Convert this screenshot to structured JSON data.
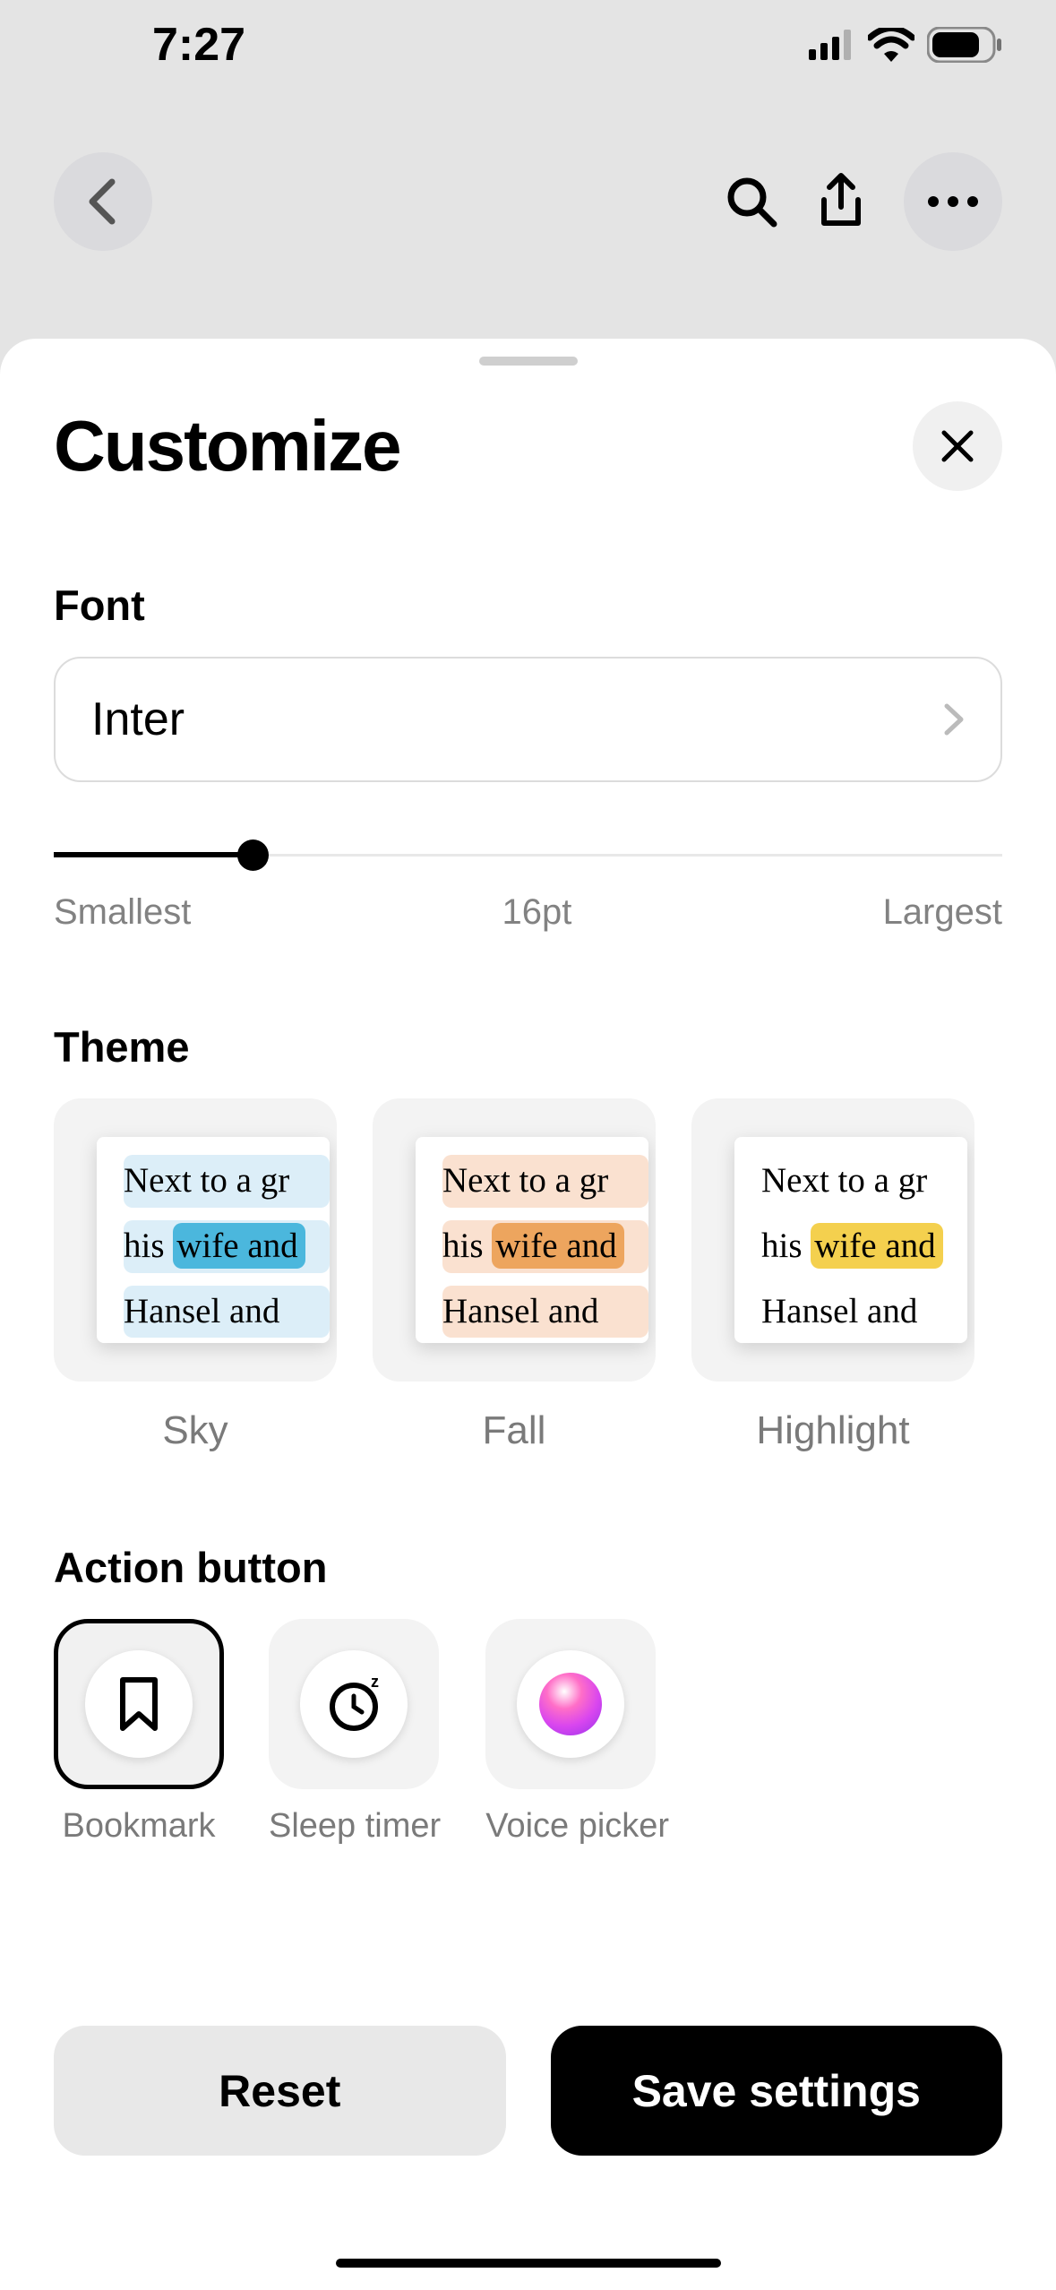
{
  "status": {
    "time": "7:27"
  },
  "sheet": {
    "title": "Customize",
    "font": {
      "label": "Font",
      "value": "Inter"
    },
    "slider": {
      "min_label": "Smallest",
      "mid_label": "16pt",
      "max_label": "Largest"
    },
    "theme": {
      "label": "Theme",
      "preview_lines": {
        "l1": "Next to a gr",
        "l2a": "his ",
        "l2b": "wife and",
        "l3": "Hansel and"
      },
      "items": [
        {
          "name": "Sky"
        },
        {
          "name": "Fall"
        },
        {
          "name": "Highlight"
        }
      ]
    },
    "action": {
      "label": "Action button",
      "items": [
        {
          "name": "Bookmark"
        },
        {
          "name": "Sleep timer"
        },
        {
          "name": "Voice picker"
        }
      ]
    },
    "footer": {
      "reset": "Reset",
      "save": "Save settings"
    }
  }
}
